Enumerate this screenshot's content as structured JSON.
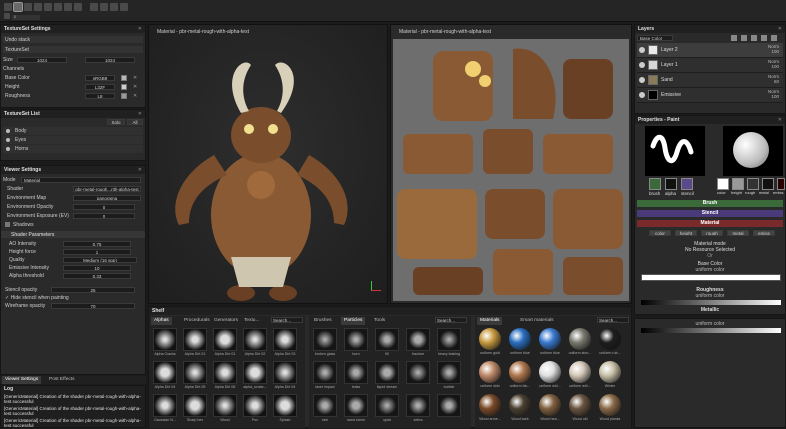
{
  "toolbar": {
    "field_value": "0"
  },
  "textureset_settings": {
    "title": "TextureSet Settings",
    "undo_label": "Undo stack",
    "textureset_label": "TextureSet",
    "size_label": "Size",
    "size_value": "1024",
    "size_value2": "1024",
    "channels_label": "Channels",
    "channels": [
      {
        "name": "Base Color",
        "format": "sRGB8",
        "color": "#b8b8b8"
      },
      {
        "name": "Height",
        "format": "L32F",
        "color": "#cfcfcf"
      },
      {
        "name": "Roughness",
        "format": "L8",
        "color": "#9a9a9a"
      }
    ]
  },
  "textureset_list": {
    "title": "TextureSet List",
    "solo_label": "Solo",
    "all_label": "All",
    "items": [
      "Body",
      "Eyes",
      "Horns"
    ]
  },
  "viewer_settings": {
    "title": "Viewer Settings",
    "mode_label": "Mode",
    "mode_value": "Material",
    "shader_label": "Shader",
    "shader_value": "pbr-metal-rough...rith-alpha-test",
    "envmap_label": "Environment Map",
    "envmap_value": "panorama",
    "env_opacity_label": "Environment Opacity",
    "env_opacity_value": "0",
    "env_exposure_label": "Environment Exposure (EV)",
    "env_exposure_value": "0",
    "shadows_label": "Shadows",
    "shader_params_label": "Shader Parameters",
    "ao_label": "AO Intensity",
    "ao_value": "0.75",
    "height_force_label": "Height force",
    "height_force_value": "1",
    "quality_label": "Quality",
    "quality_value": "Medium (16 spp)",
    "emissive_label": "Emissive Intensity",
    "emissive_value": "10",
    "alpha_threshold_label": "Alpha threshold",
    "alpha_threshold_value": "0.33",
    "stencil_opacity_label": "Stencil opacity",
    "stencil_opacity_value": "25",
    "hide_stencil_label": "Hide stencil when painting",
    "wireframe_label": "Wireframe opacity",
    "wireframe_value": "70"
  },
  "bottom_left_tabs": {
    "viewer_settings": "Viewer Settings",
    "post_effects": "Post Effects"
  },
  "log": {
    "title": "Log",
    "lines": [
      "[GenericMaterial] Creation of the shader pbr-metal-rough-with-alpha-test successful",
      "[GenericMaterial] Creation of the shader pbr-metal-rough-with-alpha-test successful",
      "[GenericMaterial] Creation of the shader pbr-metal-rough-with-alpha-test successful"
    ]
  },
  "viewport3d": {
    "title": "Material - pbr-metal-rough-with-alpha-test"
  },
  "viewport2d": {
    "title": "Material - pbr-metal-rough-with-alpha-test"
  },
  "layers": {
    "title": "Layers",
    "channel_select": "Base Color",
    "items": [
      {
        "name": "Layer 2",
        "mode": "Norm",
        "opacity": "100",
        "thumb": "#e9e9e9"
      },
      {
        "name": "Layer 1",
        "mode": "Norm",
        "opacity": "100",
        "thumb": "#d6d6d6"
      },
      {
        "name": "Sand",
        "mode": "Norm",
        "opacity": "60",
        "thumb": "#8a7a5a"
      },
      {
        "name": "Emissive",
        "mode": "Norm",
        "opacity": "100",
        "thumb": "#000000"
      }
    ]
  },
  "properties": {
    "title": "Properties - Paint",
    "tool_tabs": [
      "brush",
      "alpha",
      "stencil"
    ],
    "material_tabs": [
      "color",
      "height",
      "rough",
      "metal",
      "emiss"
    ],
    "brush_bar": "Brush",
    "stencil_bar": "Stencil",
    "material_bar": "Material",
    "channel_buttons": [
      "color",
      "height",
      "rough",
      "metal",
      "emiss"
    ],
    "material_mode_label": "Material mode",
    "material_mode_value": "No Resource Selected",
    "or_label": "Or",
    "base_color_label": "Base Color",
    "base_color_value": "uniform color",
    "roughness_label": "Roughness",
    "roughness_value": "uniform color",
    "metallic_label": "Metallic",
    "metallic_value": "uniform color"
  },
  "shelf": {
    "title": "Shelf",
    "tabs": [
      "Alphas",
      "Procedurals",
      "Generators",
      "Textu..."
    ],
    "search_placeholder": "Search...",
    "alphas": [
      "Alpha Cracks",
      "Alpha Dirt 01",
      "Alpha Dirt 01",
      "Alpha Dirt 02",
      "Alpha Dirt 03",
      "Alpha Dirt 04",
      "Alpha Dirt 05",
      "Alpha Dirt 06",
      "alpha_scratc...",
      "Alpha Dirt 04",
      "Gaussian N...",
      "Sharp hex",
      "Wood",
      "Pox",
      "Splash"
    ],
    "brush_tabs": [
      "Brushes",
      "Particles",
      "Tools"
    ],
    "brushes": [
      "broken glass",
      "burn",
      "fill",
      "fracture",
      "heavy leaking",
      "laser impact",
      "leaks",
      "liquid stream",
      "",
      "bubble",
      "rain",
      "sand storm",
      "splat",
      "zebra",
      ""
    ],
    "mat_tabs": [
      "Materials",
      "Smart materials"
    ],
    "materials": [
      {
        "name": "uniform gold",
        "color": "#c89a40"
      },
      {
        "name": "uniform blue",
        "color": "#2a6fc0"
      },
      {
        "name": "uniform blue",
        "color": "#3a7ad0"
      },
      {
        "name": "uniform ston...",
        "color": "#7a7a70"
      },
      {
        "name": "uniform rub...",
        "color": "#1e1e1e"
      },
      {
        "name": "uniform skin",
        "color": "#c08a6a"
      },
      {
        "name": "uniform blu...",
        "color": "#b0784e"
      },
      {
        "name": "uniform whi...",
        "color": "#e0e0e0"
      },
      {
        "name": "uniform whi...",
        "color": "#d4c8b8"
      },
      {
        "name": "Winter",
        "color": "#c8c0a8"
      },
      {
        "name": "Wood arme...",
        "color": "#7a4a28"
      },
      {
        "name": "Wood bark",
        "color": "#4a4030"
      },
      {
        "name": "Wood hea...",
        "color": "#806040"
      },
      {
        "name": "Wood old",
        "color": "#6a5440"
      },
      {
        "name": "Wood planks",
        "color": "#8a6a48"
      }
    ]
  }
}
